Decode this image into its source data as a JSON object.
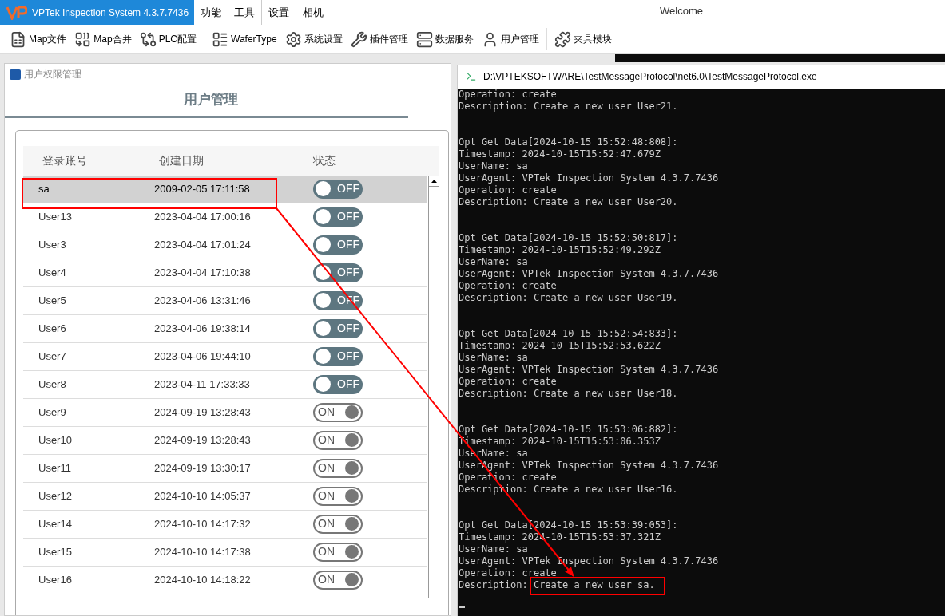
{
  "app_title": "VPTek Inspection System 4.3.7.7436",
  "menu_tabs": [
    {
      "label": "功能",
      "selected": false
    },
    {
      "label": "工具",
      "selected": false
    },
    {
      "label": "设置",
      "selected": true
    },
    {
      "label": "相机",
      "selected": false
    }
  ],
  "welcome": "Welcome",
  "toolbar": [
    {
      "kind": "file",
      "label": "Map文件"
    },
    {
      "kind": "merge",
      "label": "Map合并"
    },
    {
      "kind": "plc",
      "label": "PLC配置"
    },
    {
      "kind": "list",
      "label": "WaferType"
    },
    {
      "kind": "gear",
      "label": "系统设置"
    },
    {
      "kind": "tools",
      "label": "插件管理"
    },
    {
      "kind": "server",
      "label": "数据服务"
    },
    {
      "kind": "user",
      "label": "用户管理"
    },
    {
      "kind": "fixture",
      "label": "夹具模块"
    }
  ],
  "panel": {
    "window_title": "用户权限管理",
    "heading": "用户管理",
    "table": {
      "columns": [
        "登录账号",
        "创建日期",
        "状态"
      ],
      "rows": [
        {
          "account": "sa",
          "date": "2009-02-05 17:11:58",
          "on": false,
          "status": "OFF",
          "selected": true
        },
        {
          "account": "User13",
          "date": "2023-04-04 17:00:16",
          "on": false,
          "status": "OFF",
          "selected": false
        },
        {
          "account": "User3",
          "date": "2023-04-04 17:01:24",
          "on": false,
          "status": "OFF",
          "selected": false
        },
        {
          "account": "User4",
          "date": "2023-04-04 17:10:38",
          "on": false,
          "status": "OFF",
          "selected": false
        },
        {
          "account": "User5",
          "date": "2023-04-06 13:31:46",
          "on": false,
          "status": "OFF",
          "selected": false
        },
        {
          "account": "User6",
          "date": "2023-04-06 19:38:14",
          "on": false,
          "status": "OFF",
          "selected": false
        },
        {
          "account": "User7",
          "date": "2023-04-06 19:44:10",
          "on": false,
          "status": "OFF",
          "selected": false
        },
        {
          "account": "User8",
          "date": "2023-04-11 17:33:33",
          "on": false,
          "status": "OFF",
          "selected": false
        },
        {
          "account": "User9",
          "date": "2024-09-19 13:28:43",
          "on": true,
          "status": "ON",
          "selected": false
        },
        {
          "account": "User10",
          "date": "2024-09-19 13:28:43",
          "on": true,
          "status": "ON",
          "selected": false
        },
        {
          "account": "User11",
          "date": "2024-09-19 13:30:17",
          "on": true,
          "status": "ON",
          "selected": false
        },
        {
          "account": "User12",
          "date": "2024-10-10 14:05:37",
          "on": true,
          "status": "ON",
          "selected": false
        },
        {
          "account": "User14",
          "date": "2024-10-10 14:17:32",
          "on": true,
          "status": "ON",
          "selected": false
        },
        {
          "account": "User15",
          "date": "2024-10-10 14:17:38",
          "on": true,
          "status": "ON",
          "selected": false
        },
        {
          "account": "User16",
          "date": "2024-10-10 14:18:22",
          "on": true,
          "status": "ON",
          "selected": false
        }
      ]
    }
  },
  "console": {
    "title": "D:\\VPTEKSOFTWARE\\TestMessageProtocol\\net6.0\\TestMessageProtocol.exe",
    "blocks": [
      [
        "Operation: create",
        "Description: Create a new user User21."
      ],
      [
        "Opt Get Data[2024-10-15 15:52:48:808]:",
        "Timestamp: 2024-10-15T15:52:47.679Z",
        "UserName: sa",
        "UserAgent: VPTek Inspection System 4.3.7.7436",
        "Operation: create",
        "Description: Create a new user User20."
      ],
      [
        "Opt Get Data[2024-10-15 15:52:50:817]:",
        "Timestamp: 2024-10-15T15:52:49.292Z",
        "UserName: sa",
        "UserAgent: VPTek Inspection System 4.3.7.7436",
        "Operation: create",
        "Description: Create a new user User19."
      ],
      [
        "Opt Get Data[2024-10-15 15:52:54:833]:",
        "Timestamp: 2024-10-15T15:52:53.622Z",
        "UserName: sa",
        "UserAgent: VPTek Inspection System 4.3.7.7436",
        "Operation: create",
        "Description: Create a new user User18."
      ],
      [
        "Opt Get Data[2024-10-15 15:53:06:882]:",
        "Timestamp: 2024-10-15T15:53:06.353Z",
        "UserName: sa",
        "UserAgent: VPTek Inspection System 4.3.7.7436",
        "Operation: create",
        "Description: Create a new user User16."
      ],
      [
        "Opt Get Data[2024-10-15 15:53:39:053]:",
        "Timestamp: 2024-10-15T15:53:37.321Z",
        "UserName: sa",
        "UserAgent: VPTek Inspection System 4.3.7.7436",
        "Operation: create",
        "Description: Create a new user sa."
      ]
    ]
  }
}
